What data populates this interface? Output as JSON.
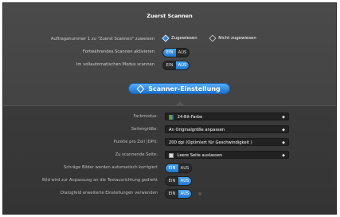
{
  "header": {
    "title": "Zuerst Scannen"
  },
  "assignment": {
    "label": "Auftraganummer 1 zu \"Zuerst Scannen\" zuweisen",
    "option_assigned": "Zugewiesen",
    "option_not_assigned": "Nicht zugewiesen"
  },
  "continue_scan": {
    "label": "Fortwährendes Scannen aktivieren",
    "on": "EIN",
    "off": "AUS"
  },
  "full_auto": {
    "label": "Im vollautomatischen Modus scannen",
    "on": "EIN",
    "off": "AUS"
  },
  "scanner_settings_button": {
    "label": "Scanner-Einstellung"
  },
  "settings": {
    "color_mode": {
      "label": "Farbmodus:",
      "value": "24-Bit-Farbe"
    },
    "page_size": {
      "label": "Seitengröße:",
      "value": "An Originalgröße anpassen"
    },
    "dpi": {
      "label": "Punkte pro Zoll (DPI):",
      "value": "200 dpi (Optimiert für Geschwindigkeit )"
    },
    "pages": {
      "label": "Zu scannende Seite:",
      "value": "Leere Seite auslassen"
    },
    "deskew": {
      "label": "Schräge Bilder werden automatisch korrigiert",
      "on": "EIN",
      "off": "AUS"
    },
    "rotate": {
      "label": "Bild wird zur Anpassung an die Textausrichtung gedreht",
      "on": "EIN",
      "off": "AUS"
    },
    "dialog": {
      "label": "Dialogfeld erweiterte Einstellungen verwenden",
      "on": "EIN",
      "off": "AUS"
    }
  },
  "colors": {
    "accent": "#2f84d8",
    "panel": "#3e3e3e"
  }
}
